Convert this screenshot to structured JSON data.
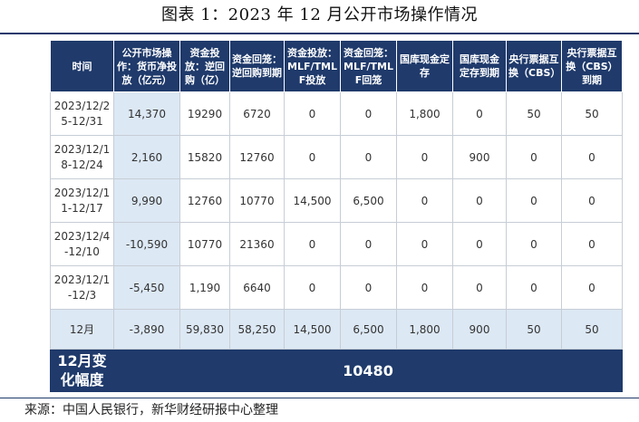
{
  "title": "图表 1：2023 年 12 月公开市场操作情况",
  "headers": [
    "时间",
    "公开市场操作：货币净投放（亿元）",
    "资金投放：逆回购（亿）",
    "资金回笼：逆回购到期",
    "资金投放：MLF/TMLF投放",
    "资金回笼：MLF/TMLF回笼",
    "国库现金定存",
    "国库现金定存到期",
    "央行票据互换（CBS）",
    "央行票据互换（CBS）到期"
  ],
  "rows": [
    [
      "2023/12/25-12/31",
      "14,370",
      "19290",
      "6720",
      "0",
      "0",
      "1,800",
      "0",
      "50",
      "50"
    ],
    [
      "2023/12/18-12/24",
      "2,160",
      "15820",
      "12760",
      "0",
      "0",
      "0",
      "900",
      "0",
      "0"
    ],
    [
      "2023/12/11-12/17",
      "9,990",
      "12760",
      "10770",
      "14,500",
      "6,500",
      "0",
      "0",
      "0",
      "0"
    ],
    [
      "2023/12/4-12/10",
      "-10,590",
      "10770",
      "21360",
      "0",
      "0",
      "0",
      "0",
      "0",
      "0"
    ],
    [
      "2023/12/1-12/3",
      "-5,450",
      "1,190",
      "6640",
      "0",
      "0",
      "0",
      "0",
      "0",
      "0"
    ]
  ],
  "total_row": [
    "12月",
    "-3,890",
    "59,830",
    "58,250",
    "14,500",
    "6,500",
    "1,800",
    "900",
    "50",
    "50"
  ],
  "change_row": {
    "label": "12月变化幅度",
    "value": "10480"
  },
  "source": "来源：中国人民银行，新华财经研报中心整理",
  "colors": {
    "header_bg": "#1f3a6b",
    "highlight_bg": "#dce8f4",
    "border": "#c7cdd6"
  }
}
